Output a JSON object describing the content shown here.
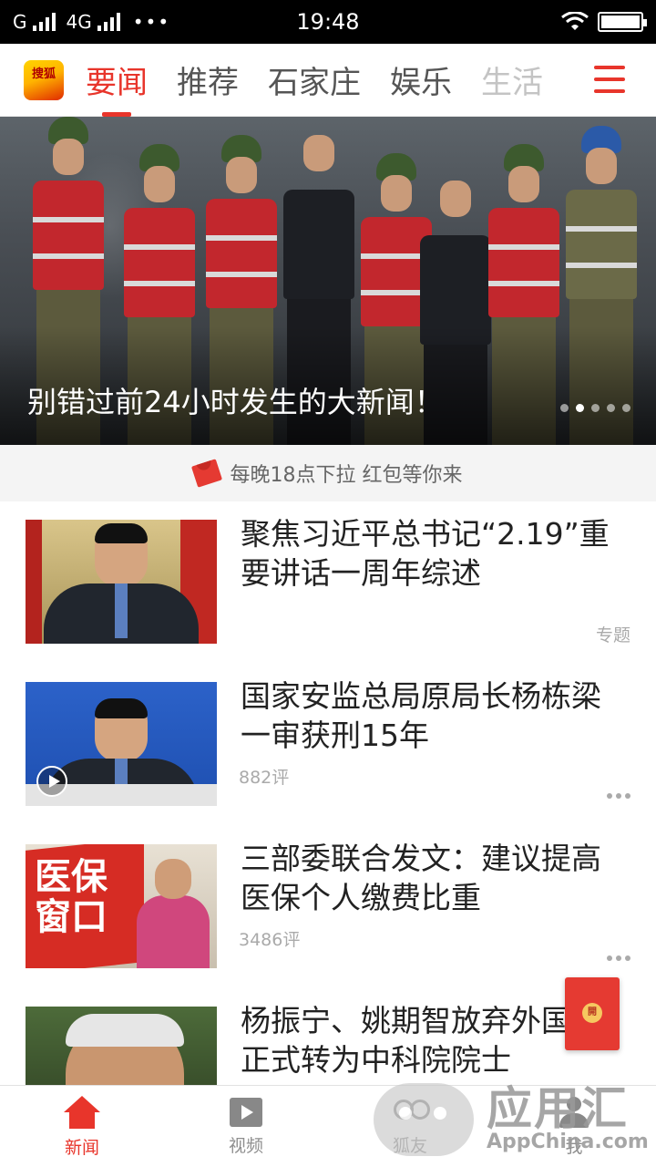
{
  "status_bar": {
    "carrier_1": "G",
    "carrier_2": "4G",
    "more": "•••",
    "time": "19:48"
  },
  "top_nav": {
    "logo_text": "搜狐",
    "tabs": [
      {
        "label": "要闻",
        "active": true
      },
      {
        "label": "推荐",
        "active": false
      },
      {
        "label": "石家庄",
        "active": false
      },
      {
        "label": "娱乐",
        "active": false
      },
      {
        "label": "生活",
        "active": false
      }
    ],
    "menu_icon": "hamburger-menu-icon",
    "accent_color": "#e8352b"
  },
  "banner": {
    "caption": "别错过前24小时发生的大新闻！",
    "slide_count": 5,
    "active_slide": 2
  },
  "promo": {
    "text": "每晚18点下拉 红包等你来"
  },
  "feed": [
    {
      "title": "聚焦习近平总书记“2.19”重要讲话一周年综述",
      "meta": "",
      "tag": "专题"
    },
    {
      "title": "国家安监总局原局长杨栋梁一审获刑15年",
      "meta": "882评",
      "tag": "",
      "has_video": true
    },
    {
      "title": "三部委联合发文：建议提高医保个人缴费比重",
      "meta": "3486评",
      "tag": "",
      "thumb_sign": "医保窗口"
    },
    {
      "title": "杨振宁、姚期智放弃外国籍 正式转为中科院院士",
      "meta": "",
      "tag": ""
    }
  ],
  "float_envelope": {
    "seal": "開"
  },
  "bottom_nav": [
    {
      "label": "新闻",
      "icon": "home-icon",
      "active": true
    },
    {
      "label": "视频",
      "icon": "video-icon",
      "active": false
    },
    {
      "label": "狐友",
      "icon": "friends-icon",
      "active": false
    },
    {
      "label": "我",
      "icon": "me-icon",
      "active": false
    }
  ],
  "watermark": {
    "title": "应用汇",
    "subtitle": "AppChina.com"
  }
}
